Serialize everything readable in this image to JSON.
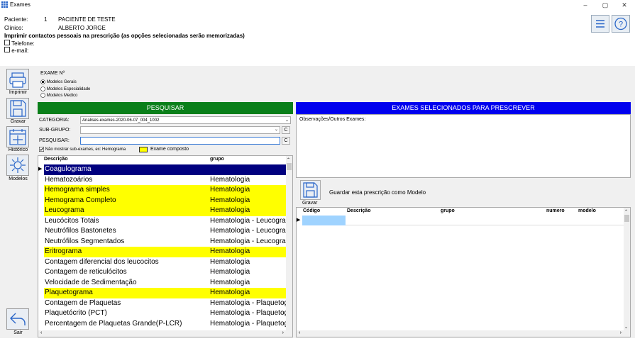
{
  "window": {
    "title": "Exames",
    "min": "–",
    "max": "▢",
    "close": "✕"
  },
  "header": {
    "paciente_label": "Paciente:",
    "paciente_num": "1",
    "paciente_name": "PACIENTE DE TESTE",
    "clinico_label": "Clínico:",
    "clinico_name": "ALBERTO JORGE",
    "print_contacts": "Imprimir contactos pessoais na prescrição (as opções selecionadas serão memorizadas)",
    "telefone": "Telefone:",
    "email": "e-mail:"
  },
  "sidebar": {
    "imprimir": "Imprimir",
    "gravar": "Gravar",
    "historico": "Histórico",
    "modelos": "Modelos",
    "sair": "Sair"
  },
  "exame": {
    "label": "EXAME Nº",
    "radio1": "Modelos Gerais",
    "radio2": "Modelos Especialidade",
    "radio3": "Modelos Medico"
  },
  "search": {
    "bar": "PESQUISAR",
    "categoria_label": "CATEGORIA:",
    "categoria_value": "Analises-exames-2020-06-07_004_1002",
    "subgrupo_label": "SUB-GRUPO:",
    "pesquisar_label": "PESQUISAR:",
    "clear": "C",
    "nao_mostrar": "Não mostrar sub-exames, ex: Hemograma",
    "exame_composto": "Exame composto",
    "col_descricao": "Descrição",
    "col_grupo": "grupo"
  },
  "rows": [
    {
      "d": "Coagulograma",
      "g": "",
      "style": "sel"
    },
    {
      "d": "Hematozoários",
      "g": "Hematologia",
      "style": ""
    },
    {
      "d": "Hemograma simples",
      "g": "Hematologia",
      "style": "yellow"
    },
    {
      "d": "Hemograma Completo",
      "g": "Hematologia",
      "style": "yellow"
    },
    {
      "d": "Leucograma",
      "g": "Hematologia",
      "style": "yellow"
    },
    {
      "d": "Leucócitos Totais",
      "g": "Hematologia - Leucograma",
      "style": ""
    },
    {
      "d": "Neutrófilos Bastonetes",
      "g": "Hematologia - Leucograma",
      "style": ""
    },
    {
      "d": "Neutrófilos Segmentados",
      "g": "Hematologia - Leucograma",
      "style": ""
    },
    {
      "d": "Eritrograma",
      "g": "Hematologia",
      "style": "yellow"
    },
    {
      "d": "Contagem diferencial dos leucocitos",
      "g": "Hematologia",
      "style": ""
    },
    {
      "d": "Contagem de reticulócitos",
      "g": "Hematologia",
      "style": ""
    },
    {
      "d": "Velocidade de Sedimentação",
      "g": "Hematologia",
      "style": ""
    },
    {
      "d": "Plaquetograma",
      "g": "Hematologia",
      "style": "yellow"
    },
    {
      "d": "Contagem de Plaquetas",
      "g": "Hematologia - Plaquetograma",
      "style": ""
    },
    {
      "d": "Plaquetócrito (PCT)",
      "g": "Hematologia - Plaquetograma",
      "style": ""
    },
    {
      "d": "Percentagem de Plaquetas Grande(P-LCR)",
      "g": "Hematologia - Plaquetograma",
      "style": ""
    }
  ],
  "selected": {
    "bar": "EXAMES SELECIONADOS PARA PRESCREVER",
    "obs_label": "Observações/Outros Exames:",
    "gravar": "Gravar",
    "guardar": "Guardar esta prescrição como Modelo",
    "col_codigo": "Código",
    "col_descricao": "Descrição",
    "col_grupo": "grupo",
    "col_numero": "numero",
    "col_modelo": "modelo"
  },
  "colors": {
    "green": "#0a7f1a",
    "blue": "#0000ee",
    "yellow": "#ffff00",
    "selected": "#00007f"
  }
}
